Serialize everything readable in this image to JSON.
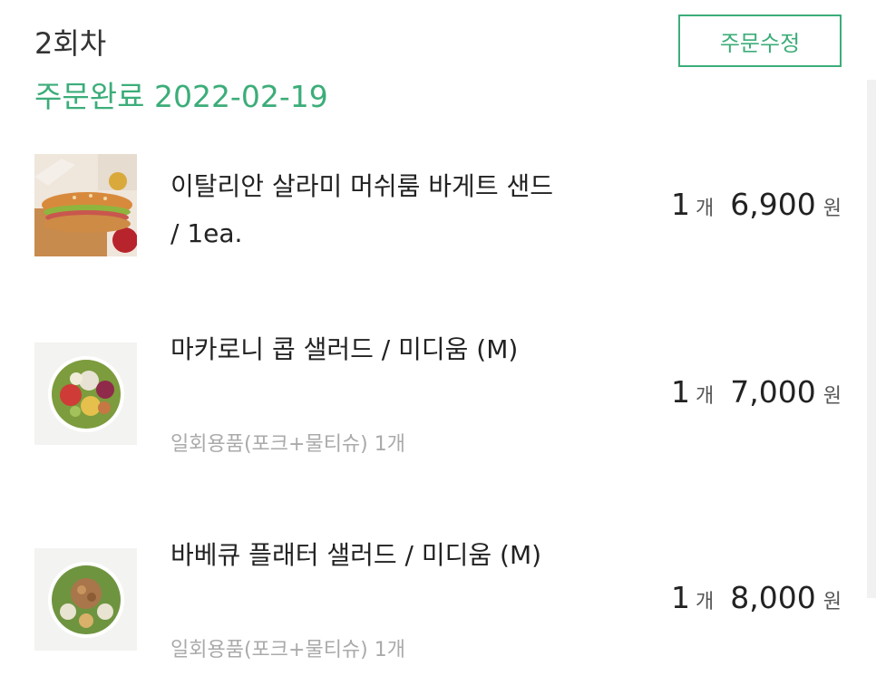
{
  "header": {
    "round_label": "2회차",
    "status_label": "주문완료",
    "order_date": "2022-02-19",
    "edit_button": "주문수정"
  },
  "items": [
    {
      "name": "이탈리안 살라미 머쉬룸 바게트 샌드 / 1ea.",
      "option": "",
      "qty": "1",
      "qty_unit": "개",
      "price": "6,900",
      "currency": "원",
      "image": "baguette-sandwich-image"
    },
    {
      "name": "마카로니 콥 샐러드 / 미디움 (M)",
      "option": "일회용품(포크+물티슈) 1개",
      "qty": "1",
      "qty_unit": "개",
      "price": "7,000",
      "currency": "원",
      "image": "cobb-salad-image"
    },
    {
      "name": "바베큐 플래터 샐러드 / 미디움 (M)",
      "option": "일회용품(포크+물티슈) 1개",
      "qty": "1",
      "qty_unit": "개",
      "price": "8,000",
      "currency": "원",
      "image": "bbq-platter-salad-image"
    }
  ],
  "colors": {
    "accent": "#3cad79",
    "text": "#222222",
    "muted": "#aaaaaa"
  }
}
